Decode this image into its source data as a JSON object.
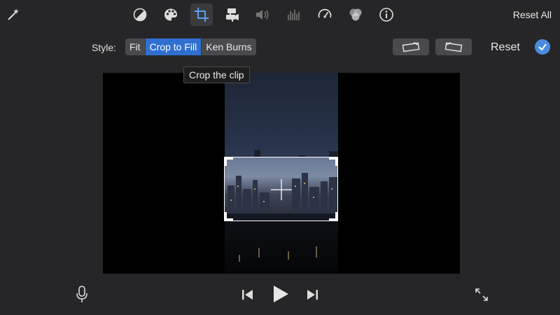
{
  "toolbar": {
    "icons": [
      "magic-wand-icon",
      "color-balance-icon",
      "color-palette-icon",
      "crop-icon",
      "stabilization-icon",
      "volume-icon",
      "equalizer-icon",
      "speed-icon",
      "filter-icon",
      "info-icon"
    ],
    "active": "crop-icon",
    "reset_all_label": "Reset All"
  },
  "style_bar": {
    "label": "Style:",
    "options": [
      "Fit",
      "Crop to Fill",
      "Ken Burns"
    ],
    "selected": "Crop to Fill",
    "reset_label": "Reset"
  },
  "tooltip": "Crop the clip",
  "colors": {
    "accent": "#2f6fd1",
    "confirm": "#4a8be0",
    "background": "#262628"
  },
  "playback": {
    "icons": [
      "microphone-icon",
      "skip-back-icon",
      "play-icon",
      "skip-forward-icon",
      "fullscreen-icon"
    ]
  }
}
